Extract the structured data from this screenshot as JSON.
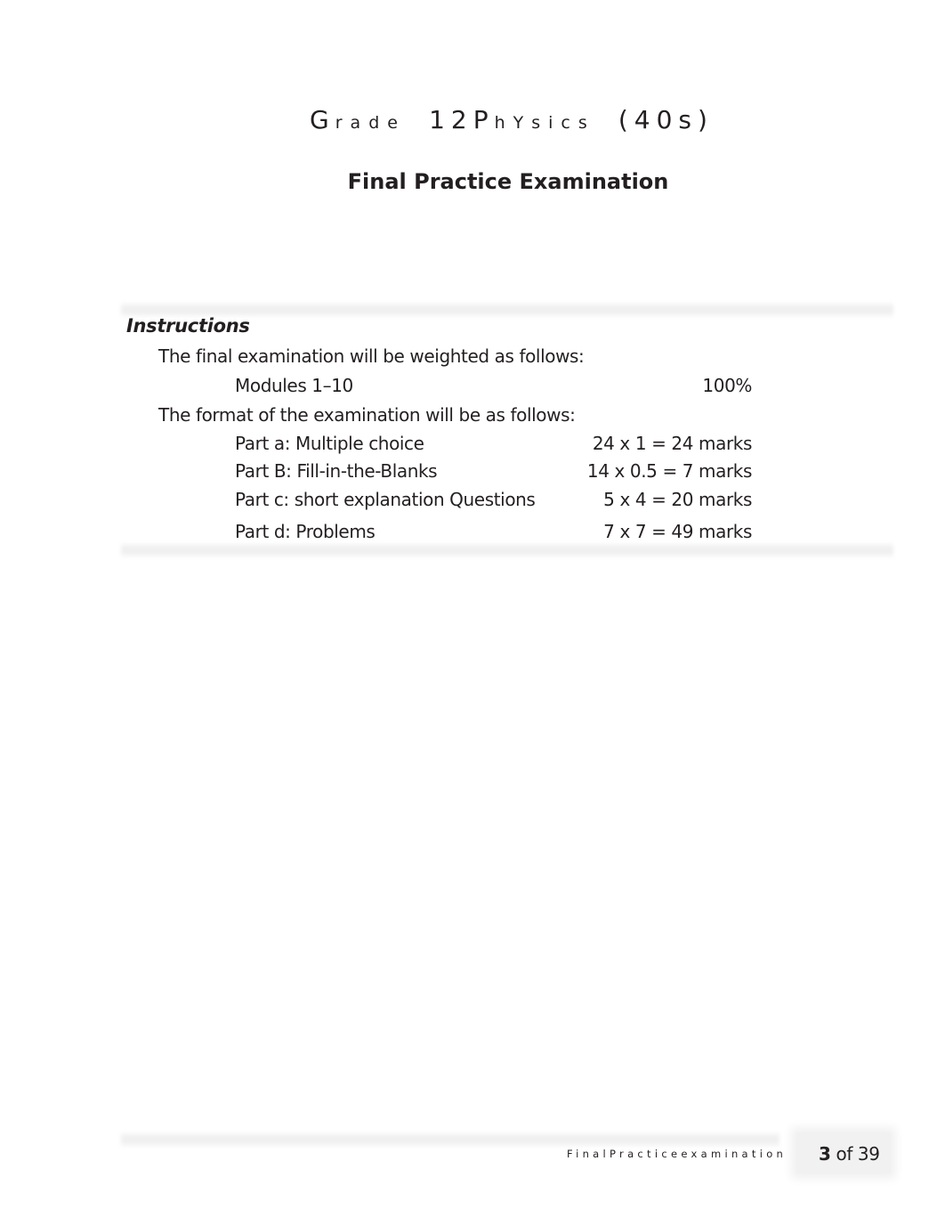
{
  "header": {
    "title_parts": [
      {
        "text": "G",
        "size": "big"
      },
      {
        "text": "rade",
        "size": "small"
      },
      {
        "text": "12",
        "size": "big"
      },
      {
        "text": "P",
        "size": "big"
      },
      {
        "text": "hYsics",
        "size": "small"
      },
      {
        "text": "(40s)",
        "size": "big"
      }
    ],
    "title_full": "Grade 12 PhYsics (40s)",
    "subtitle": "Final Practice Examination"
  },
  "instructions": {
    "heading": "Instructions",
    "weighting_intro": "The final examination will be weighted as follows:",
    "weighting": [
      {
        "label": "Modules 1–10",
        "value": "100%"
      }
    ],
    "format_intro": "The format of the examination will be as follows:",
    "parts": [
      {
        "label": "Part a: Multiple choice",
        "value": "24 x 1 = 24 marks"
      },
      {
        "label": "Part B: Fill-in-the-Blanks",
        "value": "14 x 0.5 = 7 marks"
      },
      {
        "label": "Part c: short explanation Questions",
        "value": "5 x 4 = 20 marks"
      },
      {
        "label": "Part d: Problems",
        "value": "7 x 7 = 49 marks"
      }
    ]
  },
  "footer": {
    "label": "FinalPracticeexamination",
    "page_current": "3",
    "page_of": "of 39"
  }
}
